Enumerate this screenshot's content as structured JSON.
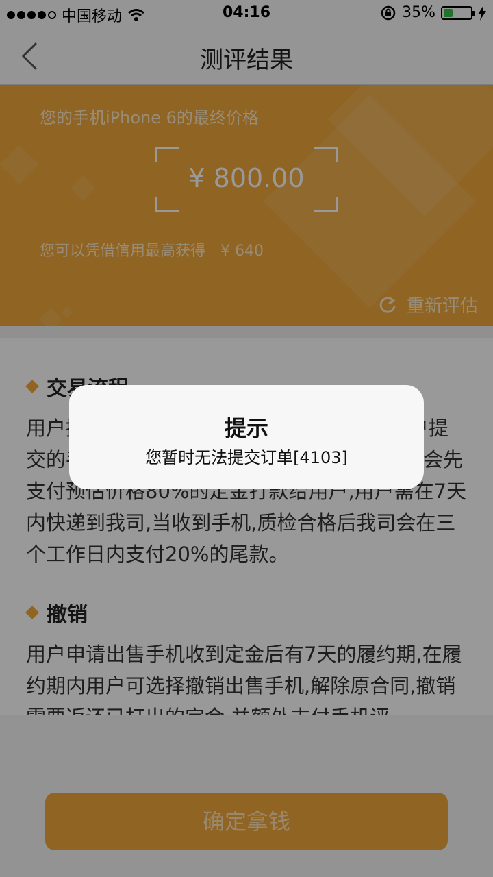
{
  "status_bar": {
    "carrier": "中国移动",
    "time": "04:16",
    "battery_percent_text": "35%",
    "battery_level": 0.35,
    "icons": [
      "signal-dots-icon",
      "wifi-icon",
      "orientation-lock-icon",
      "battery-icon",
      "charging-bolt-icon"
    ]
  },
  "nav": {
    "title": "测评结果",
    "back_icon": "chevron-left-icon"
  },
  "banner": {
    "phone_line": "您的手机iPhone 6的最终价格",
    "price": "¥ 800.00",
    "credit_line": "您可以凭借信用最高获得　¥ 640",
    "re_evaluate_label": "重新评估",
    "re_evaluate_icon": "refresh-icon",
    "background_color": "#f0a73a"
  },
  "sections": [
    {
      "title": "交易流程",
      "body": "用户提交订单后，我司会在24小时内审核用户提交的手机信息及收款账号，审核通过后，我司会先支付预估价格80%的定金打款给用户,用户需在7天内快递到我司,当收到手机,质检合格后我司会在三个工作日内支付20%的尾款。"
    },
    {
      "title": "撤销",
      "body": "用户申请出售手机收到定金后有7天的履约期,在履约期内用户可选择撤销出售手机,解除原合同,撤销需要返还已打出的定金,并额外支付手机评"
    }
  ],
  "bottom": {
    "confirm_label": "确定拿钱"
  },
  "alert": {
    "title": "提示",
    "message": "您暂时无法提交订单[4103]"
  },
  "colors": {
    "accent": "#f0a73a",
    "battery_green": "#34c24a"
  }
}
